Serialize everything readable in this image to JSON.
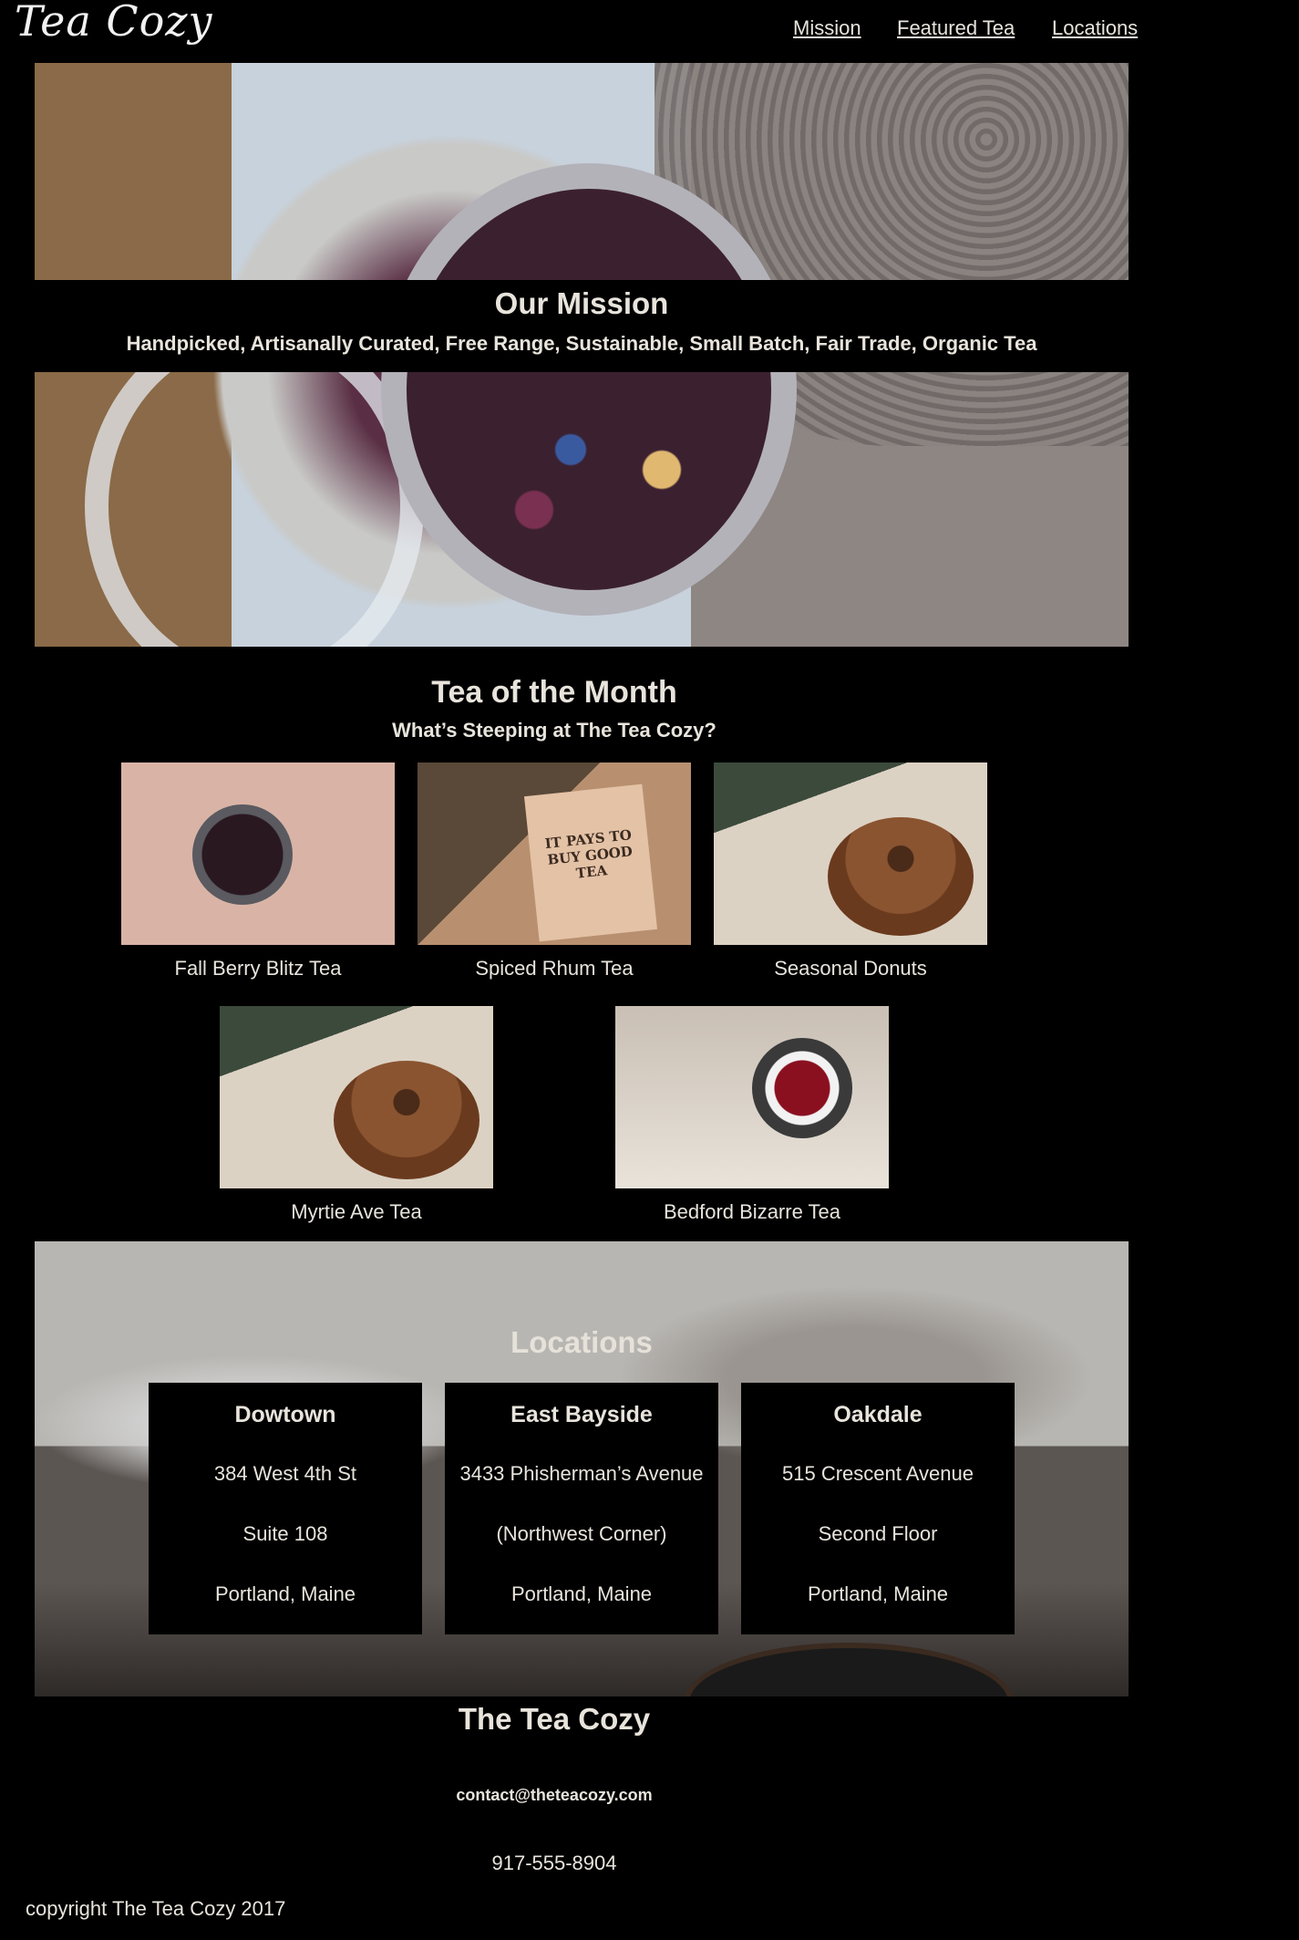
{
  "header": {
    "logo": "Tea Cozy",
    "nav": [
      {
        "label": "Mission"
      },
      {
        "label": "Featured Tea"
      },
      {
        "label": "Locations"
      }
    ]
  },
  "mission": {
    "title": "Our Mission",
    "subtitle": "Handpicked, Artisanally Curated, Free Range, Sustainable, Small Batch, Fair Trade, Organic Tea"
  },
  "tea_of_month": {
    "title": "Tea of the Month",
    "subtitle": "What’s Steeping at The Tea Cozy?",
    "items": [
      {
        "name": "Fall Berry Blitz Tea"
      },
      {
        "name": "Spiced Rhum Tea"
      },
      {
        "name": "Seasonal Donuts"
      },
      {
        "name": "Myrtie Ave Tea"
      },
      {
        "name": "Bedford Bizarre Tea"
      }
    ]
  },
  "locations": {
    "title": "Locations",
    "cards": [
      {
        "name": "Dowtown",
        "lines": [
          "384 West 4th St",
          "Suite 108",
          "Portland, Maine"
        ]
      },
      {
        "name": "East Bayside",
        "lines": [
          "3433 Phisherman’s Avenue",
          "(Northwest Corner)",
          "Portland, Maine"
        ]
      },
      {
        "name": "Oakdale",
        "lines": [
          "515 Crescent Avenue",
          "Second Floor",
          "Portland, Maine"
        ]
      }
    ]
  },
  "footer": {
    "title": "The Tea Cozy",
    "email": "contact@theteacozy.com",
    "phone": "917-555-8904",
    "copyright": "copyright The Tea Cozy 2017"
  }
}
